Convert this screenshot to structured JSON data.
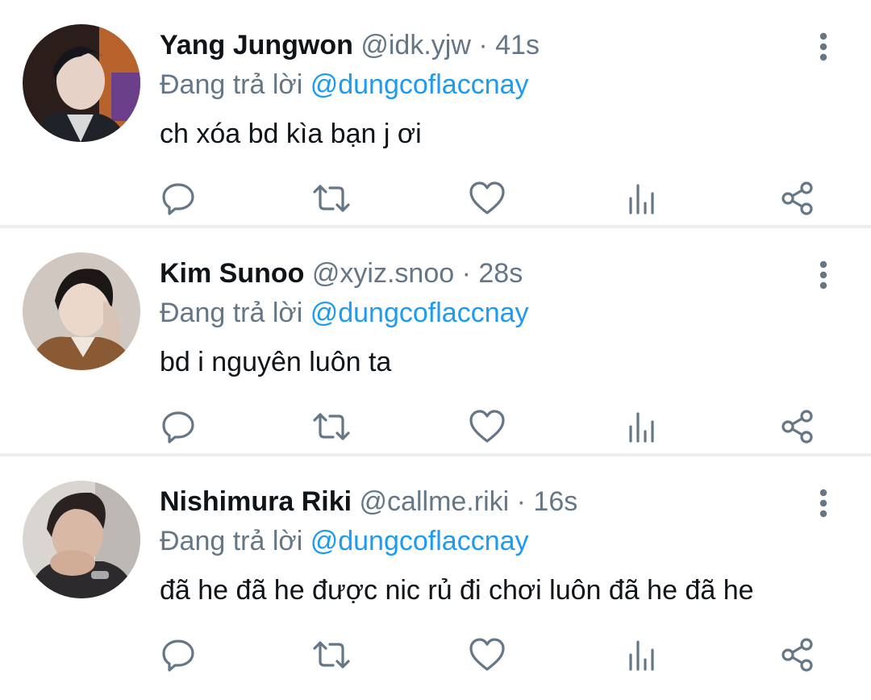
{
  "tweets": [
    {
      "name": "Yang Jungwon",
      "handle": "@idk.yjw",
      "separator": "·",
      "time": "41s",
      "reply_prefix": "Đang trả lời",
      "reply_mention": "@dungcoflaccnay",
      "text": "ch xóa bd kìa bạn j ơi"
    },
    {
      "name": "Kim Sunoo",
      "handle": "@xyiz.snoo",
      "separator": "·",
      "time": "28s",
      "reply_prefix": "Đang trả lời",
      "reply_mention": "@dungcoflaccnay",
      "text": "bd i nguyên luôn ta"
    },
    {
      "name": "Nishimura Riki",
      "handle": "@callme.riki",
      "separator": "·",
      "time": "16s",
      "reply_prefix": "Đang trả lời",
      "reply_mention": "@dungcoflaccnay",
      "text": "đã he đã he được nic rủ đi chơi luôn đã he đã he"
    }
  ],
  "icons": {
    "more": "more-vertical-icon",
    "reply": "reply-icon",
    "retweet": "retweet-icon",
    "like": "heart-icon",
    "stats": "analytics-icon",
    "share": "share-icon"
  },
  "colors": {
    "mention": "#1d9bf0",
    "secondary_text": "#657786",
    "divider": "#eceff1"
  }
}
